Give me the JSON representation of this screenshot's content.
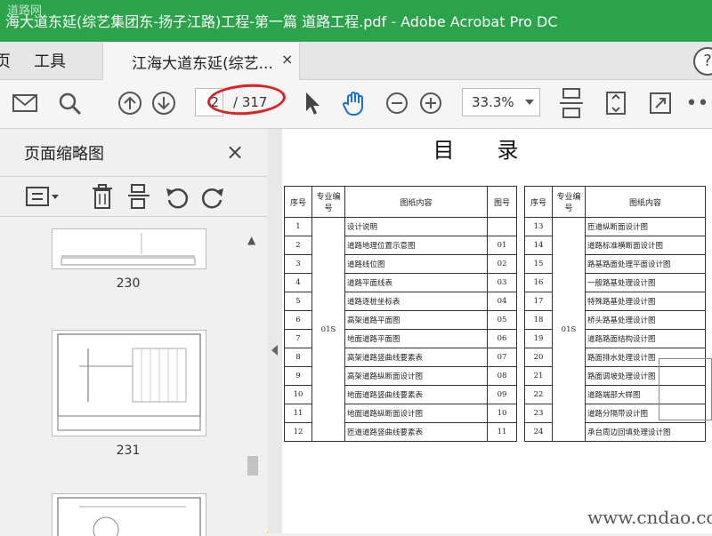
{
  "window": {
    "title": "海大道东延(综艺集团东-扬子江路)工程-第一篇 道路工程.pdf - Adobe Acrobat Pro DC"
  },
  "menu": {
    "items": [
      "页",
      "工具"
    ]
  },
  "tab": {
    "label": "江海大道东延(综艺...",
    "close": "×"
  },
  "toolbar": {
    "page_current": "2",
    "page_total": "/ 317",
    "zoom": "33.3%"
  },
  "sidebar": {
    "title": "页面缩略图",
    "close": "×",
    "thumbnails": [
      {
        "label": "230"
      },
      {
        "label": "231"
      }
    ]
  },
  "pdf": {
    "title": "目录",
    "left_headers": {
      "no": "序号",
      "speciality": "专业编号",
      "name": "图纸内容",
      "code": "图号"
    },
    "right_headers": {
      "no": "序号",
      "speciality": "专业编号",
      "name": "图纸内容"
    },
    "speciality_code": "01S",
    "left_rows": [
      {
        "no": "1",
        "name": "设计说明",
        "code": ""
      },
      {
        "no": "2",
        "name": "道路地理位置示意图",
        "code": "01"
      },
      {
        "no": "3",
        "name": "道路线位图",
        "code": "02"
      },
      {
        "no": "4",
        "name": "道路平面线表",
        "code": "03"
      },
      {
        "no": "5",
        "name": "道路逐桩坐标表",
        "code": "04"
      },
      {
        "no": "6",
        "name": "高架道路平面图",
        "code": "05"
      },
      {
        "no": "7",
        "name": "地面道路平面图",
        "code": "06"
      },
      {
        "no": "8",
        "name": "高架道路竖曲线要素表",
        "code": "07"
      },
      {
        "no": "9",
        "name": "高架道路纵断面设计图",
        "code": "08"
      },
      {
        "no": "10",
        "name": "地面道路竖曲线要素表",
        "code": "09"
      },
      {
        "no": "11",
        "name": "地面道路纵断面设计图",
        "code": "10"
      },
      {
        "no": "12",
        "name": "匝道道路竖曲线要素表",
        "code": "11"
      }
    ],
    "right_rows": [
      {
        "no": "13",
        "name": "匝道纵断面设计图"
      },
      {
        "no": "14",
        "name": "道路标准横断面设计图"
      },
      {
        "no": "15",
        "name": "路基路面处理平面设计图"
      },
      {
        "no": "16",
        "name": "一般路基处理设计图"
      },
      {
        "no": "17",
        "name": "特殊路基处理设计图"
      },
      {
        "no": "18",
        "name": "桥头路基处理设计图"
      },
      {
        "no": "19",
        "name": "道路路面结构设计图"
      },
      {
        "no": "20",
        "name": "路面排水处理设计图"
      },
      {
        "no": "21",
        "name": "路面调坡处理设计图"
      },
      {
        "no": "22",
        "name": "道路端部大样图"
      },
      {
        "no": "23",
        "name": "道路分隔带设计图"
      },
      {
        "no": "24",
        "name": "承台周边回填处理设计图"
      }
    ]
  },
  "watermark": {
    "text": "www.cndao.com",
    "logo": "道路网"
  }
}
